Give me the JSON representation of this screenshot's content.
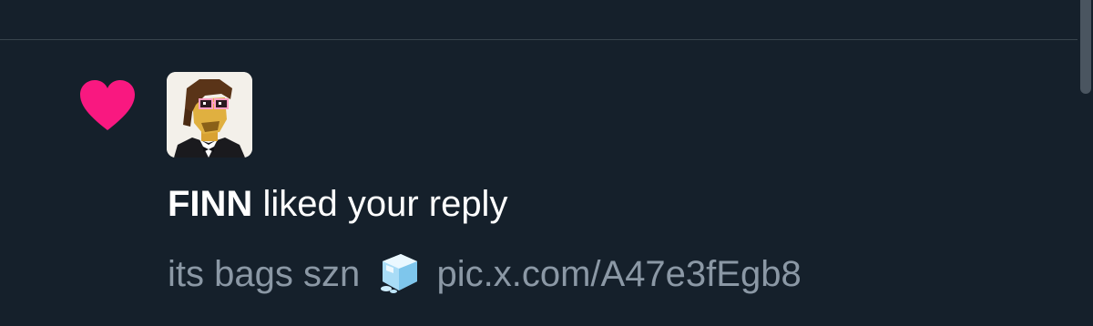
{
  "notification": {
    "user_name": "FINN",
    "action_text": " liked your reply",
    "preview_text": "its bags szn",
    "preview_link": "pic.x.com/A47e3fEgb8",
    "icon": "heart-icon",
    "emoji_icon": "ice-cube-icon"
  },
  "colors": {
    "background": "#15202b",
    "heart": "#f91880",
    "text_primary": "#ffffff",
    "text_secondary": "#8b98a5"
  }
}
